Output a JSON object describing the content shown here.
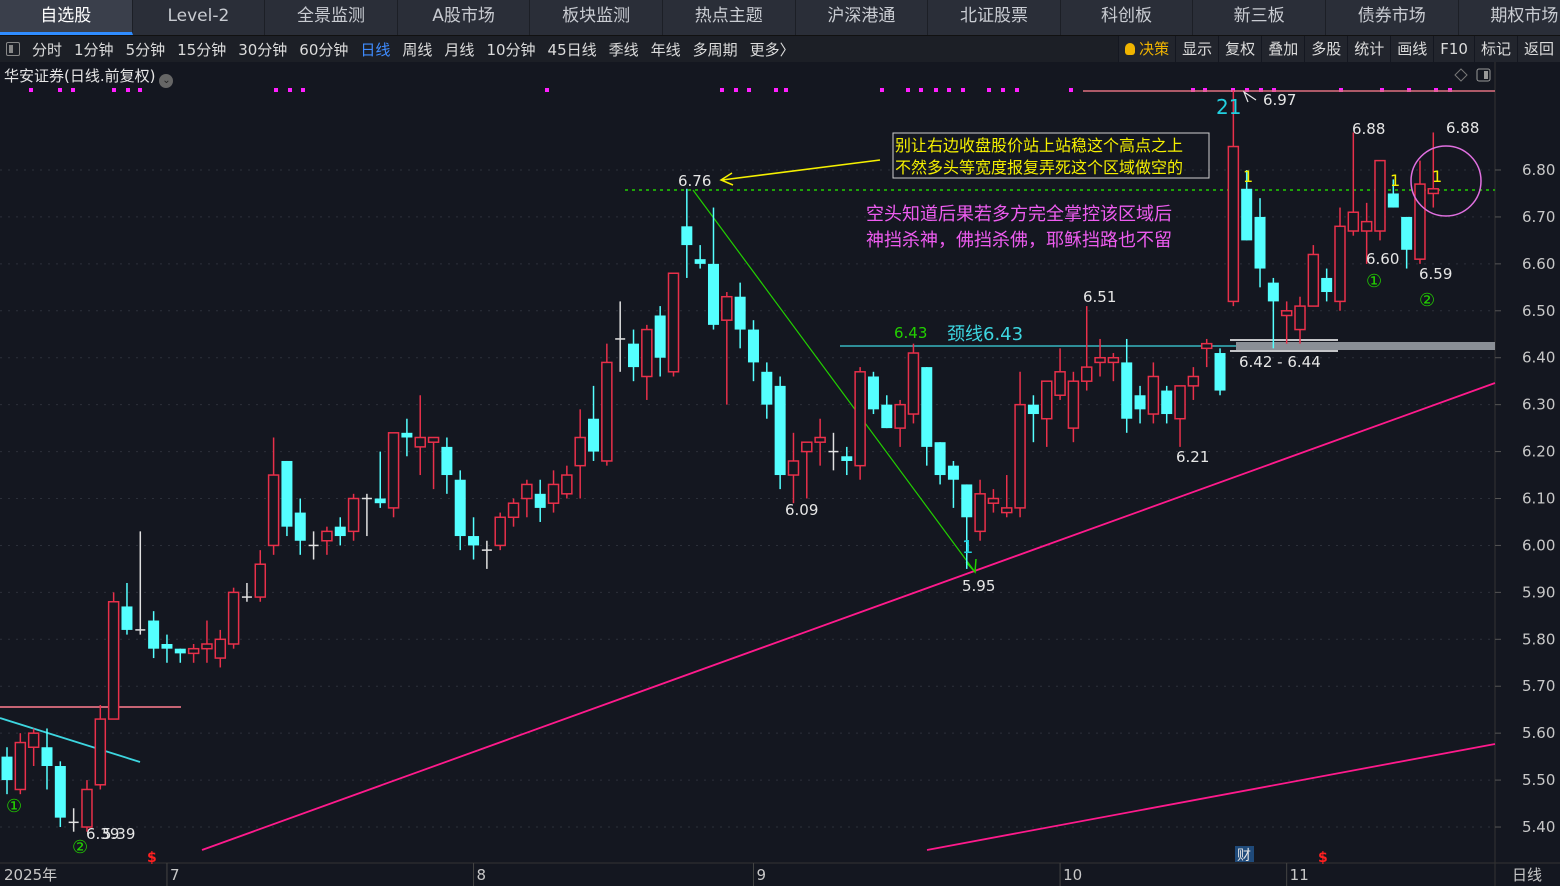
{
  "tabs": [
    "自选股",
    "Level-2",
    "全景监测",
    "A股市场",
    "板块监测",
    "热点主题",
    "沪深港通",
    "北证股票",
    "科创板",
    "新三板",
    "债券市场",
    "期权市场"
  ],
  "active_tab": "自选股",
  "periods": [
    "分时",
    "1分钟",
    "5分钟",
    "15分钟",
    "30分钟",
    "60分钟",
    "日线",
    "周线",
    "月线",
    "10分钟",
    "45日线",
    "季线",
    "年线",
    "多周期",
    "更多〉"
  ],
  "active_period": "日线",
  "tools": [
    "决策",
    "显示",
    "复权",
    "叠加",
    "多股",
    "统计",
    "画线",
    "F10",
    "标记",
    "返回"
  ],
  "stock_title": "华安证券(日线.前复权)",
  "colors": {
    "up": "#e8304a",
    "down": "#54ffff",
    "doji": "#e0e0e0",
    "trendline": "#ff1a8c",
    "neckline": "#3dd6e0",
    "accent": "#3f8cff"
  },
  "chart_data": {
    "type": "candlestick",
    "y_ticks": [
      "6.80",
      "6.70",
      "6.60",
      "6.50",
      "6.40",
      "6.30",
      "6.20",
      "6.10",
      "6.00",
      "5.90",
      "5.80",
      "5.70",
      "5.60",
      "5.50",
      "5.40"
    ],
    "ylim": [
      5.33,
      7.03
    ],
    "grid": true,
    "x_labels": [
      {
        "label": "2025年",
        "index": 0
      },
      {
        "label": "7",
        "index": 12
      },
      {
        "label": "8",
        "index": 35
      },
      {
        "label": "9",
        "index": 56
      },
      {
        "label": "10",
        "index": 79
      },
      {
        "label": "11",
        "index": 96
      }
    ],
    "period_label": "日线",
    "candles_ohlc": [
      [
        5.55,
        5.57,
        5.47,
        5.5
      ],
      [
        5.48,
        5.6,
        5.47,
        5.58
      ],
      [
        5.57,
        5.61,
        5.53,
        5.6
      ],
      [
        5.57,
        5.61,
        5.48,
        5.53
      ],
      [
        5.53,
        5.54,
        5.4,
        5.42
      ],
      [
        5.41,
        5.44,
        5.39,
        5.41
      ],
      [
        5.4,
        5.5,
        5.39,
        5.48
      ],
      [
        5.49,
        5.66,
        5.48,
        5.63
      ],
      [
        5.63,
        5.9,
        5.63,
        5.88
      ],
      [
        5.87,
        5.92,
        5.81,
        5.82
      ],
      [
        5.82,
        6.03,
        5.81,
        5.82
      ],
      [
        5.84,
        5.86,
        5.76,
        5.78
      ],
      [
        5.79,
        5.81,
        5.75,
        5.78
      ],
      [
        5.78,
        5.78,
        5.75,
        5.77
      ],
      [
        5.77,
        5.79,
        5.75,
        5.78
      ],
      [
        5.78,
        5.84,
        5.75,
        5.79
      ],
      [
        5.76,
        5.82,
        5.74,
        5.8
      ],
      [
        5.79,
        5.91,
        5.78,
        5.9
      ],
      [
        5.89,
        5.92,
        5.88,
        5.89
      ],
      [
        5.89,
        5.99,
        5.88,
        5.96
      ],
      [
        6.0,
        6.23,
        5.98,
        6.15
      ],
      [
        6.18,
        6.18,
        6.02,
        6.04
      ],
      [
        6.07,
        6.1,
        5.98,
        6.01
      ],
      [
        6.0,
        6.03,
        5.97,
        6.0
      ],
      [
        6.01,
        6.04,
        5.98,
        6.03
      ],
      [
        6.04,
        6.06,
        6.0,
        6.02
      ],
      [
        6.03,
        6.11,
        6.01,
        6.1
      ],
      [
        6.1,
        6.11,
        6.02,
        6.1
      ],
      [
        6.1,
        6.2,
        6.08,
        6.09
      ],
      [
        6.08,
        6.24,
        6.06,
        6.24
      ],
      [
        6.24,
        6.27,
        6.19,
        6.23
      ],
      [
        6.21,
        6.32,
        6.15,
        6.23
      ],
      [
        6.22,
        6.23,
        6.12,
        6.23
      ],
      [
        6.21,
        6.23,
        6.11,
        6.15
      ],
      [
        6.14,
        6.16,
        5.99,
        6.02
      ],
      [
        6.02,
        6.06,
        5.97,
        6.0
      ],
      [
        5.99,
        6.01,
        5.95,
        5.99
      ],
      [
        6.0,
        6.07,
        5.99,
        6.06
      ],
      [
        6.06,
        6.1,
        6.04,
        6.09
      ],
      [
        6.1,
        6.14,
        6.06,
        6.13
      ],
      [
        6.11,
        6.14,
        6.05,
        6.08
      ],
      [
        6.09,
        6.16,
        6.07,
        6.13
      ],
      [
        6.11,
        6.17,
        6.1,
        6.15
      ],
      [
        6.17,
        6.29,
        6.1,
        6.23
      ],
      [
        6.27,
        6.34,
        6.18,
        6.2
      ],
      [
        6.18,
        6.43,
        6.17,
        6.39
      ],
      [
        6.44,
        6.52,
        6.37,
        6.44
      ],
      [
        6.43,
        6.46,
        6.35,
        6.38
      ],
      [
        6.36,
        6.47,
        6.31,
        6.46
      ],
      [
        6.49,
        6.51,
        6.36,
        6.4
      ],
      [
        6.37,
        6.58,
        6.36,
        6.58
      ],
      [
        6.68,
        6.76,
        6.57,
        6.64
      ],
      [
        6.61,
        6.64,
        6.59,
        6.6
      ],
      [
        6.6,
        6.72,
        6.46,
        6.47
      ],
      [
        6.48,
        6.54,
        6.3,
        6.53
      ],
      [
        6.53,
        6.56,
        6.42,
        6.46
      ],
      [
        6.46,
        6.48,
        6.35,
        6.39
      ],
      [
        6.37,
        6.39,
        6.27,
        6.3
      ],
      [
        6.34,
        6.36,
        6.12,
        6.15
      ],
      [
        6.15,
        6.24,
        6.09,
        6.18
      ],
      [
        6.2,
        6.22,
        6.1,
        6.22
      ],
      [
        6.22,
        6.27,
        6.17,
        6.23
      ],
      [
        6.2,
        6.24,
        6.16,
        6.2
      ],
      [
        6.19,
        6.21,
        6.15,
        6.18
      ],
      [
        6.17,
        6.38,
        6.14,
        6.37
      ],
      [
        6.36,
        6.37,
        6.28,
        6.29
      ],
      [
        6.3,
        6.32,
        6.25,
        6.25
      ],
      [
        6.25,
        6.31,
        6.21,
        6.3
      ],
      [
        6.28,
        6.43,
        6.26,
        6.41
      ],
      [
        6.38,
        6.38,
        6.17,
        6.21
      ],
      [
        6.22,
        6.22,
        6.13,
        6.15
      ],
      [
        6.17,
        6.18,
        6.08,
        6.14
      ],
      [
        6.13,
        6.13,
        5.95,
        6.06
      ],
      [
        6.03,
        6.14,
        6.01,
        6.11
      ],
      [
        6.09,
        6.12,
        6.07,
        6.1
      ],
      [
        6.07,
        6.15,
        6.06,
        6.08
      ],
      [
        6.08,
        6.37,
        6.06,
        6.3
      ],
      [
        6.3,
        6.32,
        6.22,
        6.28
      ],
      [
        6.27,
        6.35,
        6.21,
        6.35
      ],
      [
        6.32,
        6.42,
        6.31,
        6.37
      ],
      [
        6.25,
        6.37,
        6.22,
        6.35
      ],
      [
        6.35,
        6.51,
        6.33,
        6.38
      ],
      [
        6.39,
        6.44,
        6.36,
        6.4
      ],
      [
        6.39,
        6.41,
        6.35,
        6.4
      ],
      [
        6.39,
        6.44,
        6.24,
        6.27
      ],
      [
        6.32,
        6.34,
        6.26,
        6.29
      ],
      [
        6.28,
        6.39,
        6.26,
        6.36
      ],
      [
        6.33,
        6.34,
        6.26,
        6.28
      ],
      [
        6.27,
        6.34,
        6.21,
        6.34
      ],
      [
        6.34,
        6.38,
        6.31,
        6.36
      ],
      [
        6.42,
        6.44,
        6.38,
        6.43
      ],
      [
        6.41,
        6.42,
        6.32,
        6.33
      ],
      [
        6.52,
        6.97,
        6.51,
        6.85
      ],
      [
        6.76,
        6.8,
        6.65,
        6.65
      ],
      [
        6.7,
        6.74,
        6.55,
        6.59
      ],
      [
        6.56,
        6.57,
        6.42,
        6.52
      ],
      [
        6.49,
        6.52,
        6.43,
        6.5
      ],
      [
        6.46,
        6.53,
        6.43,
        6.51
      ],
      [
        6.51,
        6.64,
        6.51,
        6.62
      ],
      [
        6.57,
        6.59,
        6.52,
        6.54
      ],
      [
        6.52,
        6.72,
        6.5,
        6.68
      ],
      [
        6.67,
        6.88,
        6.66,
        6.71
      ],
      [
        6.67,
        6.73,
        6.6,
        6.69
      ],
      [
        6.67,
        6.82,
        6.65,
        6.82
      ],
      [
        6.75,
        6.78,
        6.72,
        6.72
      ],
      [
        6.7,
        6.7,
        6.59,
        6.63
      ],
      [
        6.61,
        6.82,
        6.6,
        6.77
      ],
      [
        6.75,
        6.88,
        6.72,
        6.76
      ]
    ],
    "annotations": {
      "box_text_line1": "别让右边收盘股价站上站稳这个高点之上",
      "box_text_line2": "不然多头等宽度报复弄死这个区域做空的",
      "pink_text_line1": "空头知道后果若多方完全掌控该区域后",
      "pink_text_line2": "神挡杀神，佛挡杀佛，耶稣挡路也不留",
      "high_676": "6.76",
      "low_609": "6.09",
      "low_595": "5.95",
      "neck_price": "6.43",
      "neckline": "颈线6.43",
      "high_651": "6.51",
      "low_621": "6.21",
      "zone": "6.42 - 6.44",
      "high_697": "6.97",
      "count_21": "21",
      "high_688a": "6.88",
      "high_688b": "6.88",
      "low_660": "6.60",
      "low_659": "6.59",
      "circ1": "①",
      "circ2": "②",
      "circ1_left": "①",
      "circ2_left": "②",
      "mark_1": "1",
      "low_539a": "6.39",
      "low_539b": "5.39",
      "event_s": "$",
      "event_cai": "财"
    }
  }
}
